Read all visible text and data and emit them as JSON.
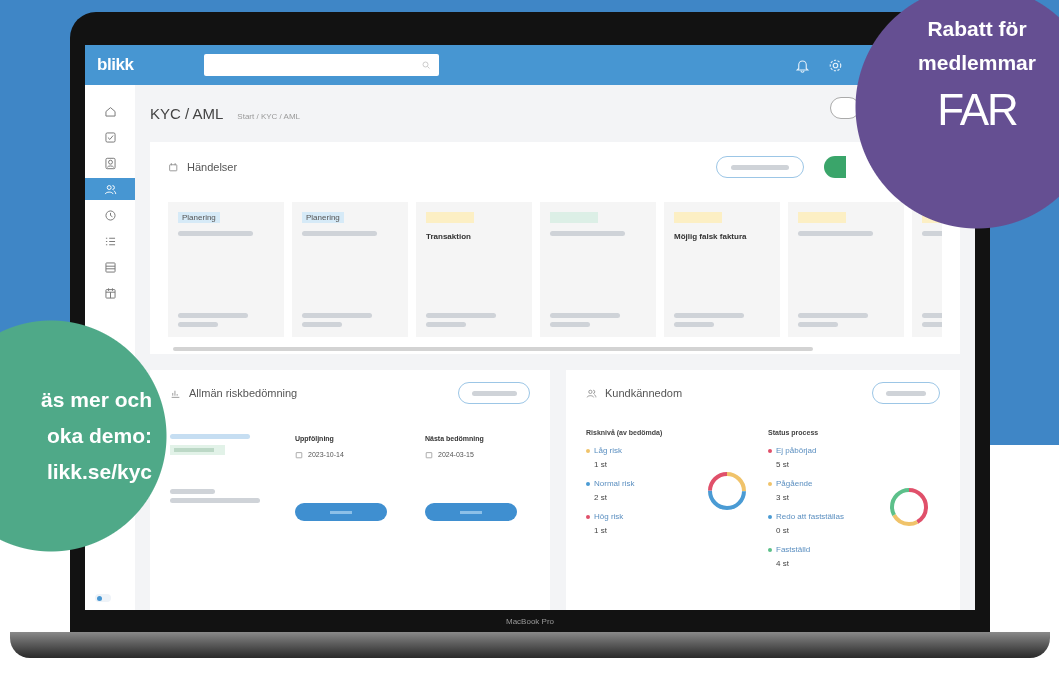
{
  "app": {
    "logo": "blikk",
    "page_title": "KYC / AML",
    "breadcrumb": "Start / KYC / AML"
  },
  "sidebar": {
    "items": [
      {
        "selected": false
      },
      {
        "selected": false
      },
      {
        "selected": false
      },
      {
        "selected": true
      },
      {
        "selected": false
      },
      {
        "selected": false
      },
      {
        "selected": false
      },
      {
        "selected": false
      }
    ],
    "toggle_on": false
  },
  "events": {
    "title": "Händelser",
    "cards": [
      {
        "tag": "Planering",
        "color": "#d6eaf7"
      },
      {
        "tag": "Planering",
        "color": "#d6eaf7"
      },
      {
        "title": "Transaktion",
        "color": "#fcefc4"
      },
      {
        "color": "#dcefe6"
      },
      {
        "title": "Möjlig falsk faktura",
        "color": "#fcefc4"
      },
      {
        "color": "#fcefc4"
      },
      {
        "color": "#fcefc4"
      }
    ]
  },
  "risk": {
    "title": "Allmän riskbedömning",
    "columns": [
      {
        "heading": "Uppföljning",
        "date": "2023-10-14"
      },
      {
        "heading": "Nästa bedömning",
        "date": "2024-03-15"
      }
    ]
  },
  "kyc": {
    "title": "Kundkännedom",
    "groups": [
      {
        "heading": "Risknivå (av bedömda)",
        "items": [
          {
            "label": "Låg risk",
            "count": "1 st",
            "color": "#f0c36a"
          },
          {
            "label": "Normal risk",
            "count": "2 st",
            "color": "#4a9bd4"
          },
          {
            "label": "Hög risk",
            "count": "1 st",
            "color": "#e0506a"
          }
        ]
      },
      {
        "heading": "Status process",
        "items": [
          {
            "label": "Ej påbörjad",
            "count": "5 st",
            "color": "#e0506a"
          },
          {
            "label": "Pågående",
            "count": "3 st",
            "color": "#f0c36a"
          },
          {
            "label": "Redo att fastställas",
            "count": "0 st",
            "color": "#4a9bd4"
          },
          {
            "label": "Fastställd",
            "count": "4 st",
            "color": "#5cc08a"
          }
        ]
      }
    ]
  },
  "promo_discount": {
    "lines": [
      "Rabatt för",
      "medlemmar"
    ],
    "logo": "FAR"
  },
  "promo_demo": {
    "lines": [
      "äs mer och",
      "oka demo:",
      "likk.se/kyc"
    ]
  },
  "device_label": "MacBook Pro"
}
